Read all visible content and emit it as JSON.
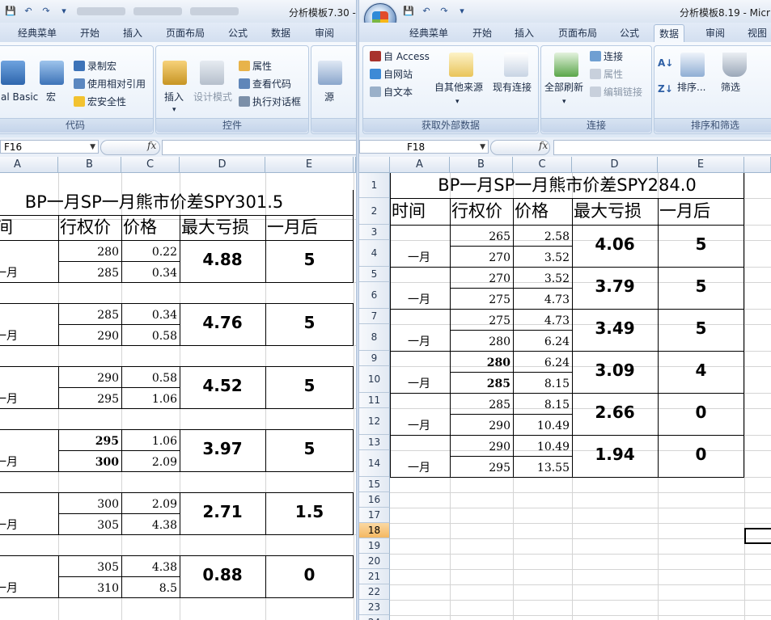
{
  "left": {
    "title": "分析模板7.30 -",
    "tabs": [
      "经典菜单",
      "开始",
      "插入",
      "页面布局",
      "公式",
      "数据",
      "审阅"
    ],
    "groups": {
      "code": {
        "label": "代码",
        "vb_label": "al Basic",
        "macro_label": "宏",
        "record_macro": "录制宏",
        "relative_ref": "使用相对引用",
        "macro_security": "宏安全性"
      },
      "controls": {
        "label": "控件",
        "insert": "插入",
        "design_mode": "设计模式",
        "properties": "属性",
        "view_code": "查看代码",
        "run_dialog": "执行对话框"
      },
      "xml": {
        "source": "源"
      }
    },
    "namebox": "F16",
    "columns": [
      "A",
      "B",
      "C",
      "D",
      "E"
    ],
    "sheet": {
      "title": "BP一月SP一月熊市价差SPY301.5",
      "headers": [
        "时间",
        "行权价",
        "价格",
        "最大亏损",
        "一月后"
      ],
      "blocks": [
        {
          "month": "一月",
          "strike1": "280",
          "price1": "0.22",
          "strike2": "285",
          "price2": "0.34",
          "max_loss": "4.88",
          "after": "5",
          "bold": false
        },
        {
          "month": "一月",
          "strike1": "285",
          "price1": "0.34",
          "strike2": "290",
          "price2": "0.58",
          "max_loss": "4.76",
          "after": "5",
          "bold": false
        },
        {
          "month": "一月",
          "strike1": "290",
          "price1": "0.58",
          "strike2": "295",
          "price2": "1.06",
          "max_loss": "4.52",
          "after": "5",
          "bold": false
        },
        {
          "month": "一月",
          "strike1": "295",
          "price1": "1.06",
          "strike2": "300",
          "price2": "2.09",
          "max_loss": "3.97",
          "after": "5",
          "bold": true
        },
        {
          "month": "一月",
          "strike1": "300",
          "price1": "2.09",
          "strike2": "305",
          "price2": "4.38",
          "max_loss": "2.71",
          "after": "1.5",
          "bold": false
        },
        {
          "month": "一月",
          "strike1": "305",
          "price1": "4.38",
          "strike2": "310",
          "price2": "8.5",
          "max_loss": "0.88",
          "after": "0",
          "bold": false
        }
      ]
    }
  },
  "right": {
    "title": "分析模板8.19 - Micr",
    "tabs": [
      "经典菜单",
      "开始",
      "插入",
      "页面布局",
      "公式",
      "数据",
      "审阅",
      "视图"
    ],
    "active_tab": "数据",
    "groups": {
      "external": {
        "label": "获取外部数据",
        "access": "自 Access",
        "web": "自网站",
        "text": "自文本",
        "other_sources": "自其他来源",
        "existing": "现有连接"
      },
      "connections": {
        "label": "连接",
        "refresh_all": "全部刷新",
        "connections": "连接",
        "properties": "属性",
        "edit_links": "编辑链接"
      },
      "sort_filter": {
        "label": "排序和筛选",
        "sort": "排序...",
        "filter": "筛选"
      }
    },
    "namebox": "F18",
    "columns": [
      "A",
      "B",
      "C",
      "D",
      "E"
    ],
    "row_numbers": [
      "1",
      "2",
      "3",
      "4",
      "5",
      "6",
      "7",
      "8",
      "9",
      "10",
      "11",
      "12",
      "13",
      "14",
      "15",
      "16",
      "17",
      "18",
      "19",
      "20",
      "21",
      "22",
      "23",
      "24"
    ],
    "selected_row": "18",
    "sheet": {
      "title": "BP一月SP一月熊市价差SPY284.0",
      "headers": [
        "时间",
        "行权价",
        "价格",
        "最大亏损",
        "一月后"
      ],
      "blocks": [
        {
          "month": "一月",
          "strike1": "265",
          "price1": "2.58",
          "strike2": "270",
          "price2": "3.52",
          "max_loss": "4.06",
          "after": "5",
          "bold": false
        },
        {
          "month": "一月",
          "strike1": "270",
          "price1": "3.52",
          "strike2": "275",
          "price2": "4.73",
          "max_loss": "3.79",
          "after": "5",
          "bold": false
        },
        {
          "month": "一月",
          "strike1": "275",
          "price1": "4.73",
          "strike2": "280",
          "price2": "6.24",
          "max_loss": "3.49",
          "after": "5",
          "bold": false
        },
        {
          "month": "一月",
          "strike1": "280",
          "price1": "6.24",
          "strike2": "285",
          "price2": "8.15",
          "max_loss": "3.09",
          "after": "4",
          "bold": true
        },
        {
          "month": "一月",
          "strike1": "285",
          "price1": "8.15",
          "strike2": "290",
          "price2": "10.49",
          "max_loss": "2.66",
          "after": "0",
          "bold": false
        },
        {
          "month": "一月",
          "strike1": "290",
          "price1": "10.49",
          "strike2": "295",
          "price2": "13.55",
          "max_loss": "1.94",
          "after": "0",
          "bold": false
        }
      ]
    }
  },
  "colors": {
    "ribbon_border": "#b8cbe2",
    "selected_header": "#f4b862",
    "gridline": "#d4d4d4"
  }
}
